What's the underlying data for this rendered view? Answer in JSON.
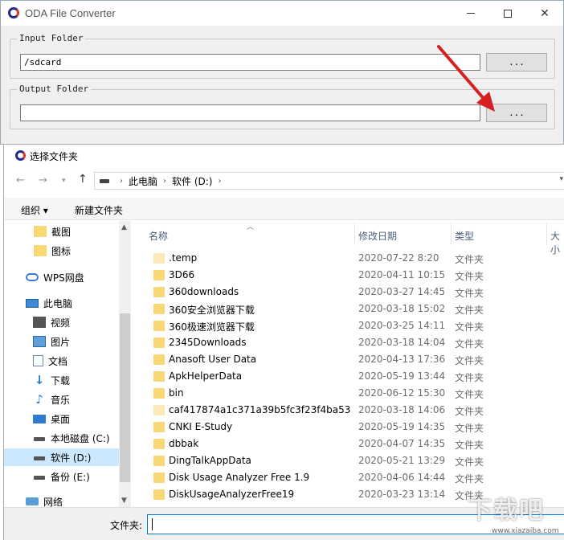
{
  "oda": {
    "title": "ODA File Converter",
    "input_group": {
      "label": "Input Folder",
      "value": "/sdcard",
      "browse_label": "..."
    },
    "output_group": {
      "label": "Output Folder",
      "value": "",
      "browse_label": "..."
    }
  },
  "dialog": {
    "title": "选择文件夹",
    "breadcrumb": [
      "此电脑",
      "软件 (D:)"
    ],
    "toolbar": {
      "organize": "组织 ▾",
      "new_folder": "新建文件夹"
    },
    "sidebar": [
      {
        "label": "截图",
        "icon": "folder-icon"
      },
      {
        "label": "图标",
        "icon": "folder-icon"
      },
      {
        "label": "WPS网盘",
        "icon": "cloud-icon"
      },
      {
        "label": "此电脑",
        "icon": "computer-icon"
      },
      {
        "label": "视频",
        "icon": "video-icon"
      },
      {
        "label": "图片",
        "icon": "pictures-icon"
      },
      {
        "label": "文档",
        "icon": "documents-icon"
      },
      {
        "label": "下载",
        "icon": "download-icon"
      },
      {
        "label": "音乐",
        "icon": "music-icon"
      },
      {
        "label": "桌面",
        "icon": "desktop-icon"
      },
      {
        "label": "本地磁盘 (C:)",
        "icon": "drive-icon"
      },
      {
        "label": "软件 (D:)",
        "icon": "drive-icon",
        "selected": true
      },
      {
        "label": "备份 (E:)",
        "icon": "drive-icon"
      },
      {
        "label": "网络",
        "icon": "network-icon"
      }
    ],
    "columns": {
      "name": "名称",
      "date": "修改日期",
      "type": "类型",
      "size": "大小"
    },
    "files": [
      {
        "name": ".temp",
        "date": "2020-07-22 8:20",
        "type": "文件夹",
        "pale": true
      },
      {
        "name": "3D66",
        "date": "2020-04-11 10:15",
        "type": "文件夹"
      },
      {
        "name": "360downloads",
        "date": "2020-03-27 14:45",
        "type": "文件夹"
      },
      {
        "name": "360安全浏览器下载",
        "date": "2020-03-18 15:02",
        "type": "文件夹"
      },
      {
        "name": "360极速浏览器下载",
        "date": "2020-03-25 14:11",
        "type": "文件夹"
      },
      {
        "name": "2345Downloads",
        "date": "2020-03-18 14:04",
        "type": "文件夹"
      },
      {
        "name": "Anasoft User Data",
        "date": "2020-04-13 17:36",
        "type": "文件夹"
      },
      {
        "name": "ApkHelperData",
        "date": "2020-05-19 13:44",
        "type": "文件夹"
      },
      {
        "name": "bin",
        "date": "2020-06-12 15:30",
        "type": "文件夹"
      },
      {
        "name": "caf417874a1c371a39b5fc3f23f4ba53",
        "date": "2020-03-18 14:06",
        "type": "文件夹",
        "pale": true
      },
      {
        "name": "CNKI E-Study",
        "date": "2020-05-19 14:35",
        "type": "文件夹"
      },
      {
        "name": "dbbak",
        "date": "2020-04-07 14:35",
        "type": "文件夹"
      },
      {
        "name": "DingTalkAppData",
        "date": "2020-05-21 13:29",
        "type": "文件夹"
      },
      {
        "name": "Disk Usage Analyzer Free 1.9",
        "date": "2020-04-06 14:44",
        "type": "文件夹"
      },
      {
        "name": "DiskUsageAnalyzerFree19",
        "date": "2020-03-23 13:14",
        "type": "文件夹"
      }
    ],
    "footer": {
      "folder_label": "文件夹:",
      "folder_value": ""
    }
  },
  "watermark": {
    "text": "下载吧",
    "sub": "www.xiazaiba.com"
  },
  "colors": {
    "arrow": "#d42020",
    "selection": "#cce8ff",
    "folder": "#f8d775"
  }
}
